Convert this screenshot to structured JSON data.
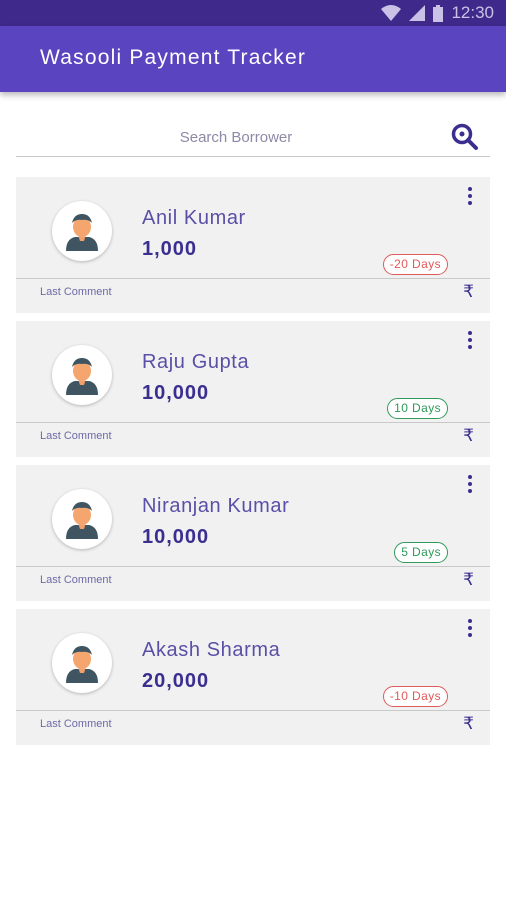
{
  "status_bar": {
    "time": "12:30"
  },
  "app_bar": {
    "title": "Wasooli Payment Tracker"
  },
  "search": {
    "placeholder": "Search Borrower",
    "icon": "search-icon"
  },
  "colors": {
    "primary": "#5b44bf",
    "status_bar": "#3f2a8c",
    "overdue": "#e05a5a",
    "due": "#2f9a5a"
  },
  "borrowers": [
    {
      "name": "Anil Kumar",
      "amount": "1,000",
      "days": "-20 Days",
      "status": "overdue",
      "comment_label": "Last Comment",
      "currency": "₹"
    },
    {
      "name": "Raju Gupta",
      "amount": "10,000",
      "days": "10 Days",
      "status": "due",
      "comment_label": "Last Comment",
      "currency": "₹"
    },
    {
      "name": "Niranjan Kumar",
      "amount": "10,000",
      "days": "5 Days",
      "status": "due",
      "comment_label": "Last Comment",
      "currency": "₹"
    },
    {
      "name": "Akash Sharma",
      "amount": "20,000",
      "days": "-10 Days",
      "status": "overdue",
      "comment_label": "Last Comment",
      "currency": "₹"
    }
  ]
}
